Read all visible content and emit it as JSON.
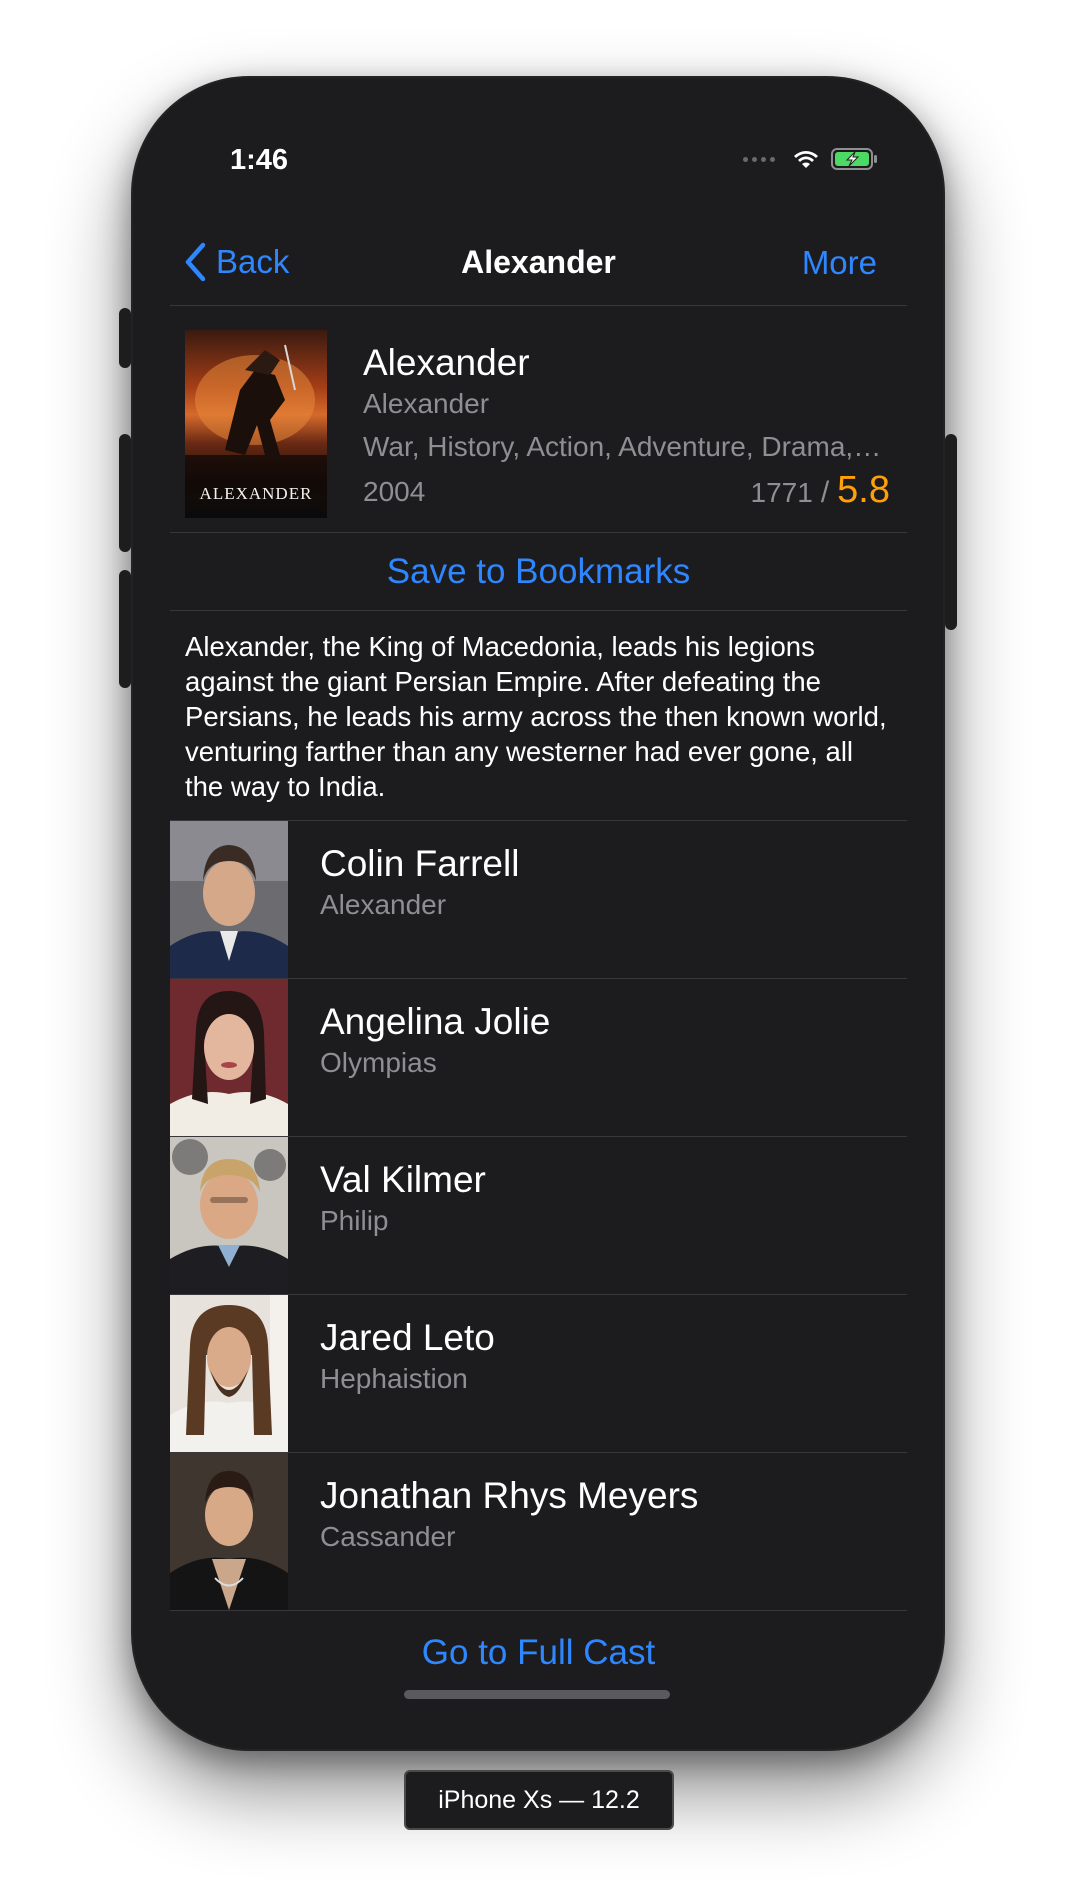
{
  "status_bar": {
    "time": "1:46",
    "icons": [
      "signal-dots-icon",
      "wifi-icon",
      "battery-charging-icon"
    ]
  },
  "nav": {
    "back_label": "Back",
    "title": "Alexander",
    "more_label": "More"
  },
  "movie": {
    "poster_text": "ALEXANDER",
    "title": "Alexander",
    "original_title": "Alexander",
    "genres": "War, History, Action, Adventure, Drama, Romance",
    "year": "2004",
    "vote_count": "1771",
    "rating_separator": "/",
    "rating": "5.8"
  },
  "bookmark_label": "Save to Bookmarks",
  "overview": "Alexander, the King of Macedonia, leads his legions against the giant Persian Empire. After defeating the Persians, he leads his army across the then known world, venturing farther than any westerner had ever gone, all the way to India.",
  "cast": [
    {
      "name": "Colin Farrell",
      "role": "Alexander"
    },
    {
      "name": "Angelina Jolie",
      "role": "Olympias"
    },
    {
      "name": "Val Kilmer",
      "role": "Philip"
    },
    {
      "name": "Jared Leto",
      "role": "Hephaistion"
    },
    {
      "name": "Jonathan Rhys Meyers",
      "role": "Cassander"
    }
  ],
  "full_cast_label": "Go to Full Cast",
  "device_label": "iPhone Xs — 12.2",
  "colors": {
    "accent": "#2f87ff",
    "rating": "#ff9f0a",
    "background": "#1c1c1e",
    "secondary_text": "#8e8e93"
  }
}
